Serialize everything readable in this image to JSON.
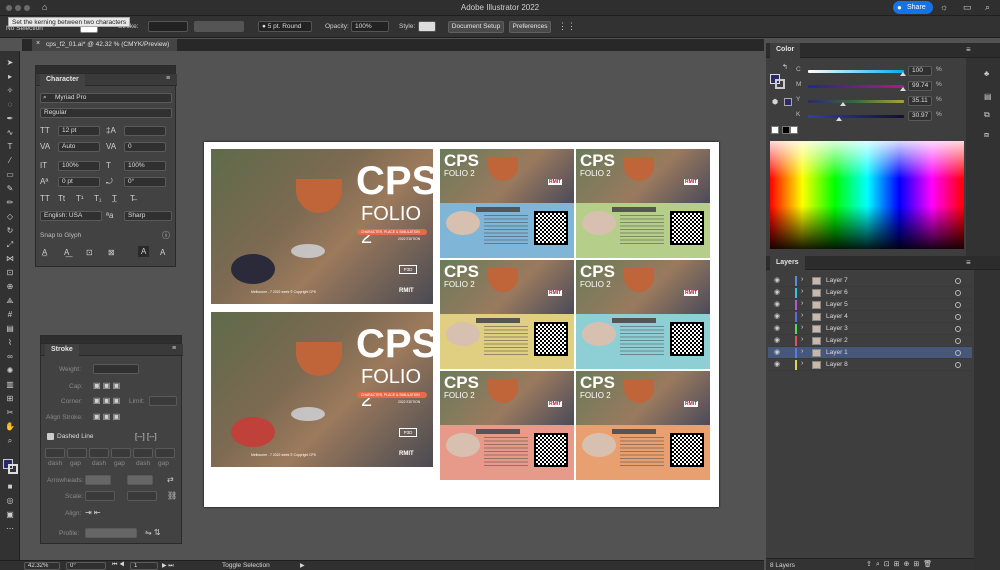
{
  "app": {
    "title": "Adobe Illustrator 2022",
    "share_label": "Share"
  },
  "tooltip": "Set the kerning between two characters",
  "controlbar": {
    "selection": "No Selection",
    "stroke_label": "Stroke:",
    "brush": "5 pt. Round",
    "opacity_label": "Opacity:",
    "opacity_value": "100%",
    "style_label": "Style:",
    "document_setup": "Document Setup",
    "preferences": "Preferences"
  },
  "doc_tab": {
    "name": "cps_f2_01.ai* @ 42.32 % (CMYK/Preview)"
  },
  "character_panel": {
    "title": "Character",
    "font_family": "Myriad Pro",
    "font_style": "Regular",
    "font_size": "12 pt",
    "leading": "Auto",
    "tracking": "0",
    "horiz_scale": "100%",
    "vert_scale": "100%",
    "baseline": "0 pt",
    "rotation": "0°",
    "language": "English: USA",
    "antialias": "Sharp",
    "snap_label": "Snap to Glyph"
  },
  "stroke_panel": {
    "title": "Stroke",
    "weight_label": "Weight:",
    "cap_label": "Cap:",
    "corner_label": "Corner:",
    "limit_label": "Limit:",
    "align_label": "Align Stroke:",
    "dashed_label": "Dashed Line",
    "dash_labels": [
      "dash",
      "gap",
      "dash",
      "gap",
      "dash",
      "gap"
    ],
    "arrowheads_label": "Arrowheads:",
    "scale_label": "Scale:",
    "align2_label": "Align:",
    "profile_label": "Profile:"
  },
  "color_panel": {
    "title": "Color",
    "channels": [
      {
        "name": "C",
        "value": "100",
        "unit": "%",
        "fraction": 1.0
      },
      {
        "name": "M",
        "value": "99.74",
        "unit": "%",
        "fraction": 0.9974
      },
      {
        "name": "Y",
        "value": "35.11",
        "unit": "%",
        "fraction": 0.3511
      },
      {
        "name": "K",
        "value": "30.97",
        "unit": "%",
        "fraction": 0.3097
      }
    ]
  },
  "layers_panel": {
    "title": "Layers",
    "layers": [
      {
        "name": "Layer 7",
        "color": "#5a8fd6"
      },
      {
        "name": "Layer 6",
        "color": "#3fbfd8"
      },
      {
        "name": "Layer 5",
        "color": "#b05ad6"
      },
      {
        "name": "Layer 4",
        "color": "#5a6fd6"
      },
      {
        "name": "Layer 3",
        "color": "#5ad65a"
      },
      {
        "name": "Layer 2",
        "color": "#d65a5a"
      },
      {
        "name": "Layer 1",
        "color": "#5a7fd6",
        "selected": true
      },
      {
        "name": "Layer 8",
        "color": "#d6d65a"
      }
    ],
    "count": "8 Layers"
  },
  "status": {
    "zoom": "42.32%",
    "rotation": "0°",
    "artboard": "1",
    "mode": "Toggle Selection"
  },
  "artwork": {
    "poster_title": "CPS",
    "poster_sub": "FOLIO 2",
    "poster_tag": "CHARACTER, PLACE & SIMULATION",
    "poster_edition": "2022 EDITION",
    "poster_badge": "P3D",
    "poster_footer": "Melbourne - 7 2022 week © Copyright CPS",
    "brand": "RMIT"
  },
  "colors": {
    "accent": "#1473e6",
    "panel": "#424242",
    "fill_swatch": "#2a2a6a"
  }
}
